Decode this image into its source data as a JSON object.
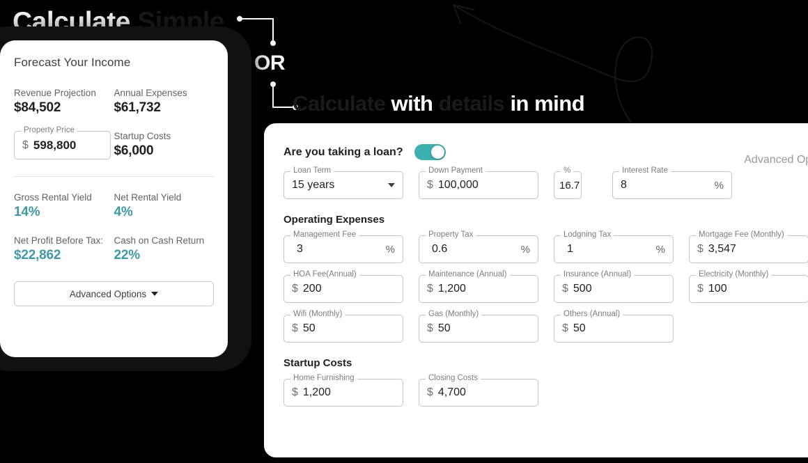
{
  "headline_top": {
    "part1": "Calculate",
    "part2": "Simple"
  },
  "headline_bottom": {
    "part1": "Calculate",
    "part2": "with",
    "part3": "details",
    "part4": "in mind"
  },
  "or_label": "OR",
  "forecast_card": {
    "title": "Forecast Your Income",
    "metrics": [
      {
        "label": "Revenue Projection",
        "value": "$84,502"
      },
      {
        "label": "Annual Expenses",
        "value": "$61,732"
      },
      {
        "label": "Startup Costs",
        "value": "$6,000"
      },
      {
        "label": "Gross Rental Yield",
        "value": "14%"
      },
      {
        "label": "Net Rental Yield",
        "value": "4%"
      },
      {
        "label": "Net Profit Before Tax:",
        "value": "$22,862"
      },
      {
        "label": "Cash on Cash Return",
        "value": "22%"
      }
    ],
    "property_price": {
      "legend": "Property Price",
      "prefix": "$",
      "value": "598,800"
    },
    "advanced_options_label": "Advanced Options"
  },
  "detail_panel": {
    "loan_question": "Are you taking a loan?",
    "loan_toggle_state": "on",
    "advanced_options_link": "Advanced Options",
    "loan_fields": [
      {
        "legend": "Loan Term",
        "prefix": "",
        "value": "15 years",
        "suffix": "",
        "control": "select"
      },
      {
        "legend": "Down Payment",
        "prefix": "$",
        "value": "100,000",
        "suffix": "",
        "control": "text"
      },
      {
        "legend": "%",
        "prefix": "",
        "value": "16.7",
        "suffix": "",
        "control": "text-narrow"
      },
      {
        "legend": "Interest Rate",
        "prefix": "",
        "value": "8",
        "suffix": "%",
        "control": "text"
      }
    ],
    "operating_expenses_title": "Operating Expenses",
    "operating_expenses": [
      {
        "legend": "Management Fee",
        "prefix": "",
        "value": "3",
        "suffix": "%"
      },
      {
        "legend": "Property Tax",
        "prefix": "",
        "value": "0.6",
        "suffix": "%"
      },
      {
        "legend": "Lodgning Tax",
        "prefix": "",
        "value": "1",
        "suffix": "%"
      },
      {
        "legend": "Mortgage Fee (Monthly)",
        "prefix": "$",
        "value": "3,547",
        "suffix": ""
      },
      {
        "legend": "HOA Fee(Annual)",
        "prefix": "$",
        "value": "200",
        "suffix": ""
      },
      {
        "legend": "Maintenance (Annual)",
        "prefix": "$",
        "value": "1,200",
        "suffix": ""
      },
      {
        "legend": "Insurance (Annual)",
        "prefix": "$",
        "value": "500",
        "suffix": ""
      },
      {
        "legend": "Electricity (Monthly)",
        "prefix": "$",
        "value": "100",
        "suffix": ""
      },
      {
        "legend": "Wifi (Monthly)",
        "prefix": "$",
        "value": "50",
        "suffix": ""
      },
      {
        "legend": "Gas (Monthly)",
        "prefix": "$",
        "value": "50",
        "suffix": ""
      },
      {
        "legend": "Others (Annual)",
        "prefix": "$",
        "value": "50",
        "suffix": ""
      }
    ],
    "startup_costs_title": "Startup Costs",
    "startup_costs": [
      {
        "legend": "Home Furnishing",
        "prefix": "$",
        "value": "1,200",
        "suffix": ""
      },
      {
        "legend": "Closing Costs",
        "prefix": "$",
        "value": "4,700",
        "suffix": ""
      }
    ]
  },
  "colors": {
    "accent_teal": "#3f98a3",
    "toggle_teal": "#3cb0ae",
    "background": "#000000",
    "card": "#ffffff",
    "headline_dark": "#1a1a1a"
  }
}
